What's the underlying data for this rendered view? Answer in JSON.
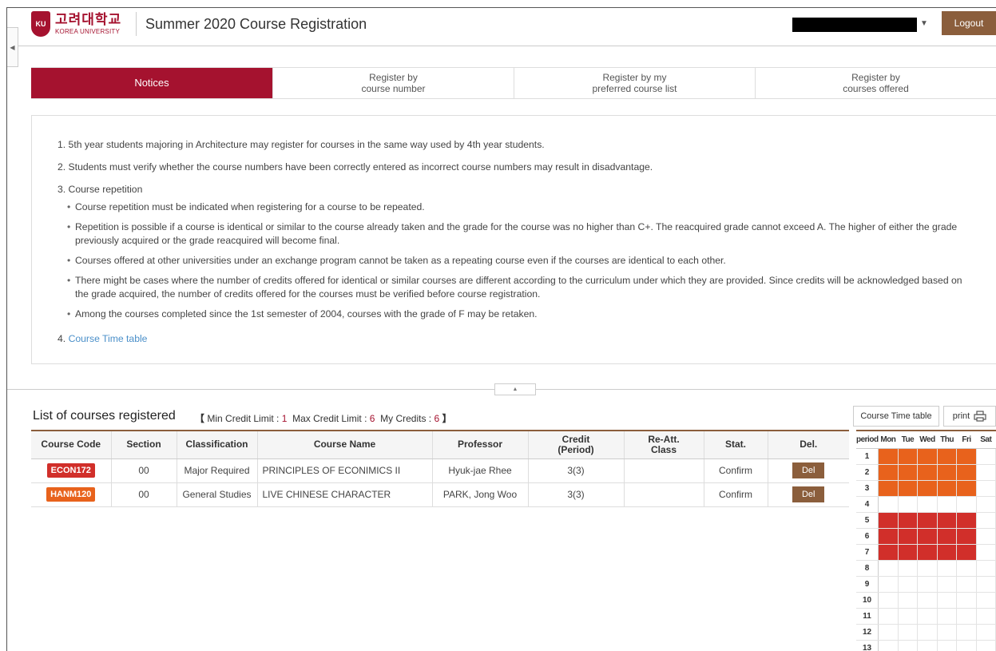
{
  "header": {
    "logo_korean": "고려대학교",
    "logo_english": "KOREA UNIVERSITY",
    "title": "Summer 2020 Course Registration",
    "logout_label": "Logout"
  },
  "tabs": [
    {
      "label_line1": "Notices",
      "label_line2": "",
      "active": true
    },
    {
      "label_line1": "Register by",
      "label_line2": "course number",
      "active": false
    },
    {
      "label_line1": "Register by my",
      "label_line2": "preferred course list",
      "active": false
    },
    {
      "label_line1": "Register by",
      "label_line2": "courses offered",
      "active": false
    }
  ],
  "notices": {
    "item1": "1. 5th year students majoring in Architecture may register for courses in the same way used by 4th year students.",
    "item2": "2. Students must verify whether the course numbers have been correctly entered as incorrect course numbers may result in disadvantage.",
    "item3": "3. Course repetition",
    "sub": [
      "Course repetition must be indicated when registering for a course to be repeated.",
      "Repetition is possible if a course is identical or similar to the course already taken and the grade for the course was no higher than C+. The reacquired grade cannot exceed A. The higher of either the grade previously acquired or the grade reacquired will become final.",
      "Courses offered at other universities under an exchange program cannot be taken as a repeating course even if the courses are identical to each other.",
      "There might be cases where the number of credits offered for identical or similar courses are different according to the curriculum under which they are provided. Since credits will be acknowledged based on the grade acquired, the number of credits offered for the courses must be verified before course registration.",
      "Among the courses completed since the 1st semester of 2004, courses with the grade of F may be retaken."
    ],
    "item4_prefix": "4. ",
    "item4_link": "Course Time table"
  },
  "registered": {
    "title": "List of courses registered",
    "bracket_open": "【",
    "bracket_close": "】",
    "min_label": "Min Credit Limit : ",
    "min_value": "1",
    "max_label": "Max Credit Limit : ",
    "max_value": "6",
    "my_label": "My Credits : ",
    "my_value": "6",
    "columns": [
      "Course Code",
      "Section",
      "Classification",
      "Course Name",
      "Professor",
      "Credit\n(Period)",
      "Re-Att.\nClass",
      "Stat.",
      "Del."
    ],
    "rows": [
      {
        "code": "ECON172",
        "code_color": "#d12f2a",
        "section": "00",
        "classification": "Major Required",
        "name": "PRINCIPLES OF ECONIMICS II",
        "professor": "Hyuk-jae Rhee",
        "credit": "3(3)",
        "reatt": "",
        "stat": "Confirm",
        "del": "Del"
      },
      {
        "code": "HANM120",
        "code_color": "#e8621c",
        "section": "00",
        "classification": "General Studies",
        "name": "LIVE CHINESE CHARACTER",
        "professor": "PARK, Jong Woo",
        "credit": "3(3)",
        "reatt": "",
        "stat": "Confirm",
        "del": "Del"
      }
    ]
  },
  "timetable": {
    "button_label": "Course Time table",
    "print_label": "print",
    "headers": [
      "period",
      "Mon",
      "Tue",
      "Wed",
      "Thu",
      "Fri",
      "Sat"
    ],
    "periods": [
      "1",
      "2",
      "3",
      "4",
      "5",
      "6",
      "7",
      "8",
      "9",
      "10",
      "11",
      "12",
      "13"
    ],
    "filled": {
      "HANM120": {
        "color": "#e8621c",
        "days": [
          "Mon",
          "Tue",
          "Wed",
          "Thu",
          "Fri"
        ],
        "periods": [
          1,
          2,
          3
        ]
      },
      "ECON172": {
        "color": "#d12f2a",
        "days": [
          "Mon",
          "Tue",
          "Wed",
          "Thu",
          "Fri"
        ],
        "periods": [
          5,
          6,
          7
        ]
      }
    }
  }
}
